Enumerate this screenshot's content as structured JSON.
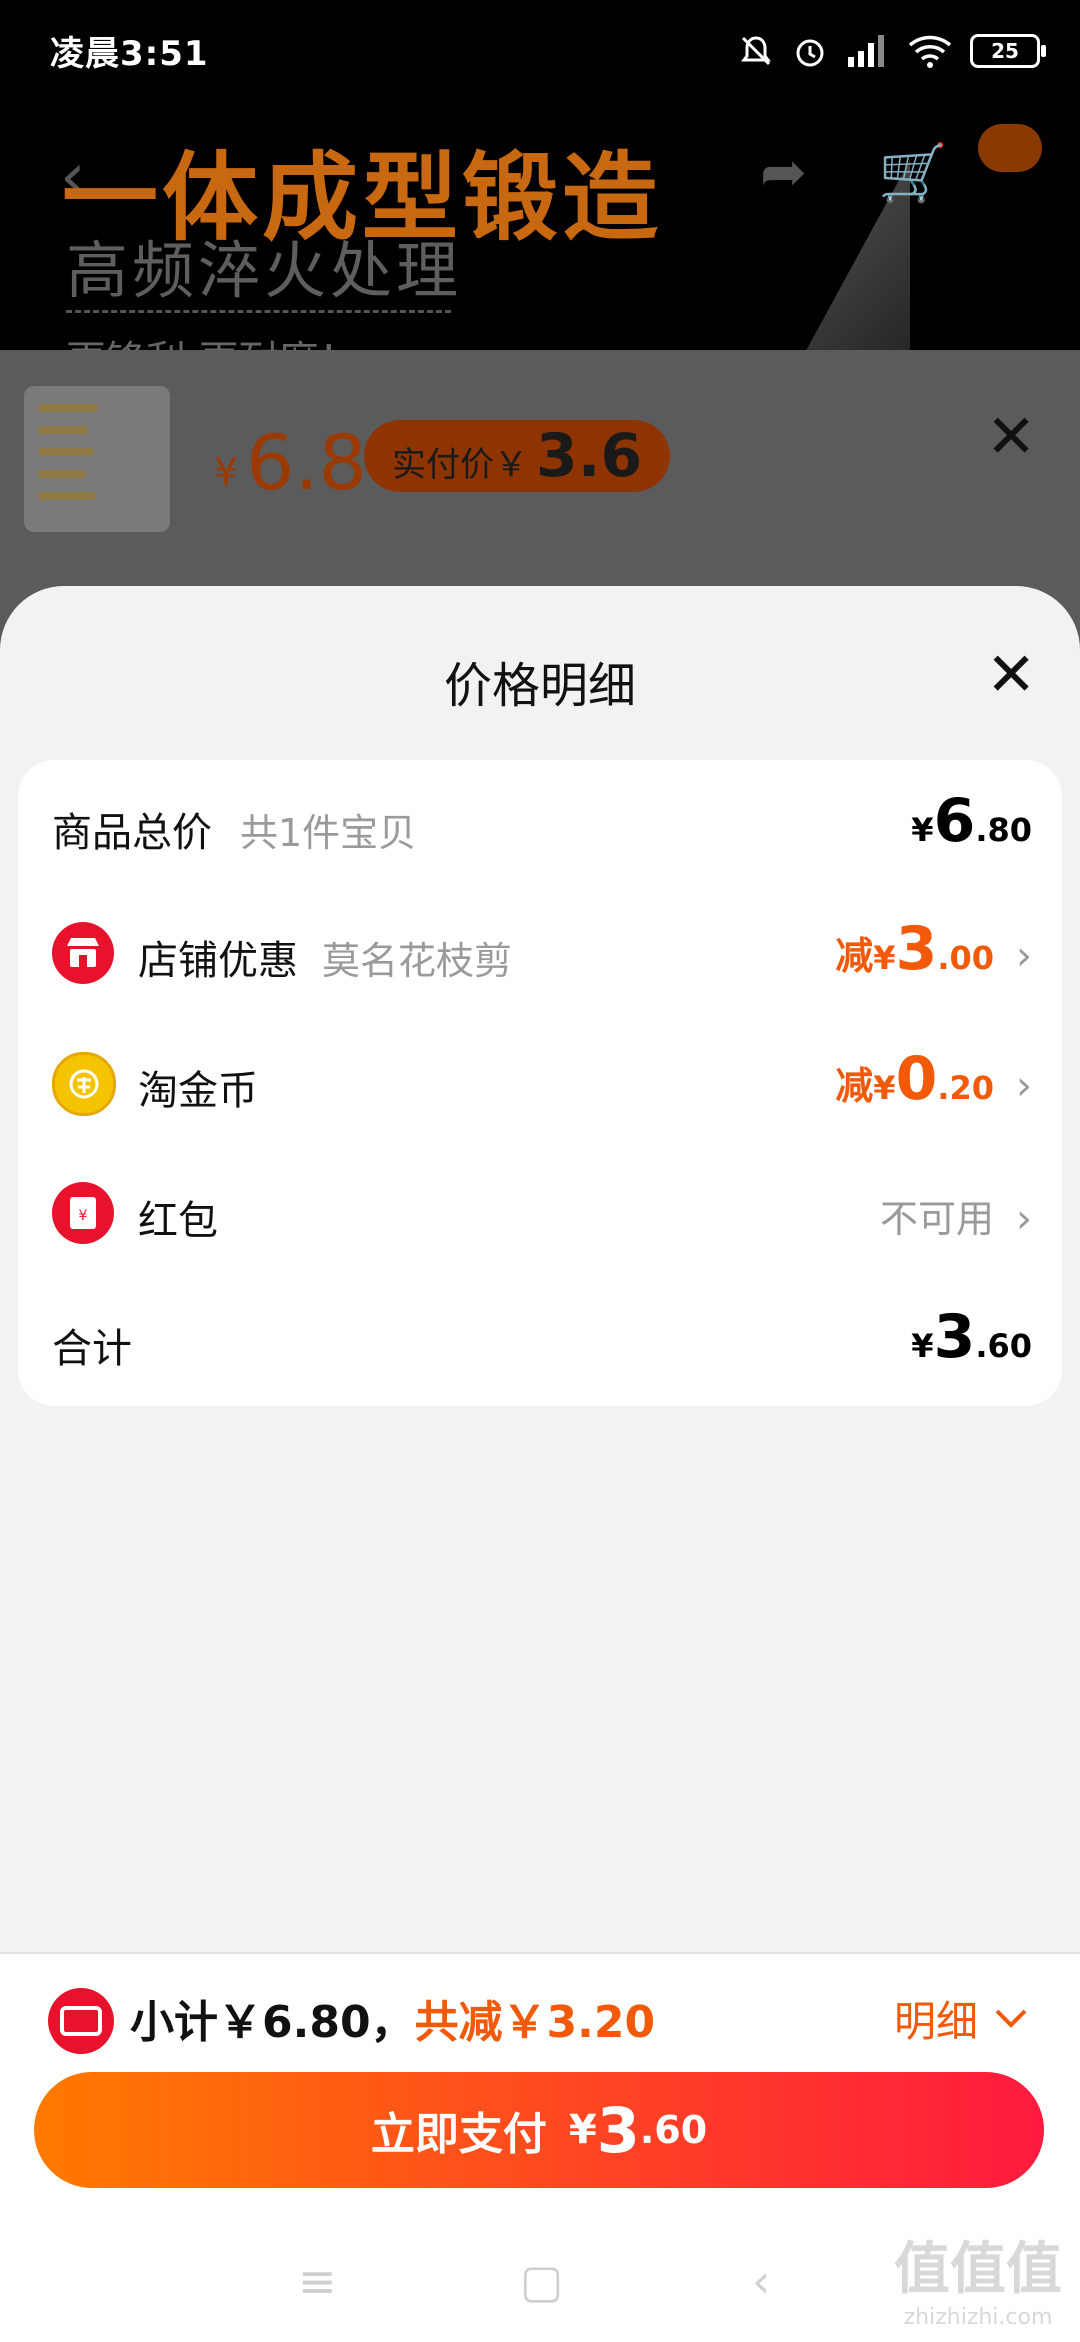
{
  "status_bar": {
    "time": "凌晨3:51",
    "battery": "25"
  },
  "banner": {
    "headline": "一体成型锻造",
    "subheadline": "高频淬火处理",
    "tagline": "更锋利 更耐磨！"
  },
  "product": {
    "yen": "¥",
    "price": "6.8",
    "realpay_label": "实付价￥",
    "realpay_value": "3.6"
  },
  "sheet": {
    "title": "价格明细",
    "rows": [
      {
        "label": "商品总价",
        "sub": "共1件宝贝",
        "prefix": "",
        "yen": "¥",
        "int": "6",
        "dec": ".80"
      },
      {
        "label": "店铺优惠",
        "sub": "莫名花枝剪",
        "prefix": "减",
        "yen": "¥",
        "int": "3",
        "dec": ".00",
        "icon": "store-icon"
      },
      {
        "label": "淘金币",
        "sub": "",
        "prefix": "减",
        "yen": "¥",
        "int": "0",
        "dec": ".20",
        "icon": "gold-coin-icon"
      },
      {
        "label": "红包",
        "sub": "",
        "status": "不可用",
        "icon": "red-packet-icon"
      },
      {
        "label": "合计",
        "sub": "",
        "prefix": "",
        "yen": "¥",
        "int": "3",
        "dec": ".60"
      }
    ]
  },
  "bottom": {
    "subtotal": "小计￥6.80，",
    "savings": "共减￥3.20",
    "detail": "明细",
    "pay_label": "立即支付",
    "pay_yen": "¥",
    "pay_int": "3",
    "pay_dec": ".60"
  },
  "watermark": {
    "main": "值值值",
    "sub": "zhizhizhi.com"
  },
  "colors": {
    "accent": "#f25a0a",
    "pay_start": "#ff7a00",
    "pay_end": "#ff1a3e",
    "red": "#e8122c",
    "gold": "#f5c400"
  }
}
